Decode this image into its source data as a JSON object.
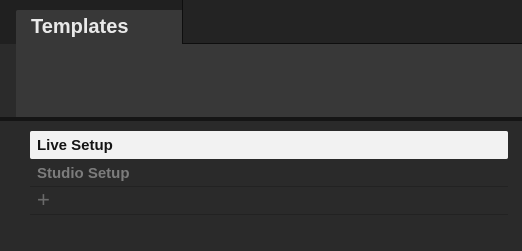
{
  "tabs": {
    "active_label": "Templates"
  },
  "templates": {
    "items": [
      {
        "label": "Live Setup",
        "selected": true
      },
      {
        "label": "Studio Setup",
        "selected": false
      }
    ],
    "add_label": "+"
  }
}
